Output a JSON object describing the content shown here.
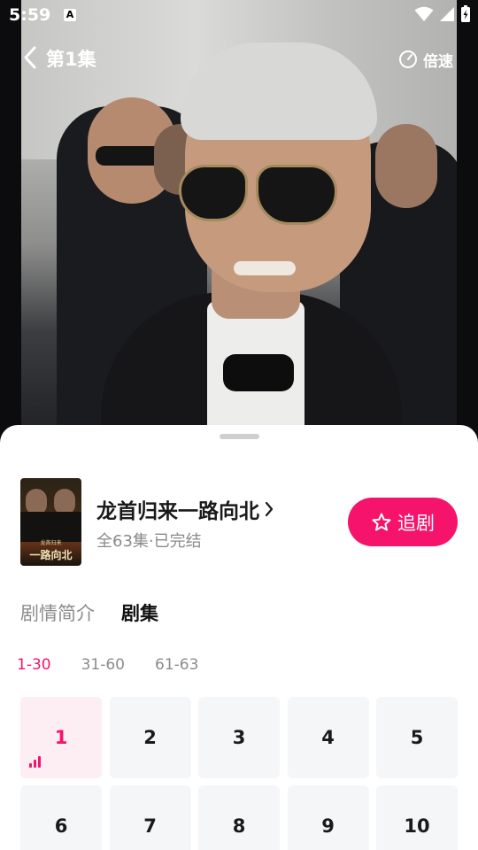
{
  "status_bar": {
    "time": "5:59",
    "notification_letter": "A"
  },
  "player": {
    "episode_title": "第1集",
    "speed_label": "倍速"
  },
  "drama": {
    "title": "龙首归来一路向北",
    "subtitle": "全63集·已完结",
    "poster_text": "一路向北",
    "poster_small_text": "龙首归来",
    "follow_label": "追剧"
  },
  "tabs": [
    {
      "label": "剧情简介",
      "active": false
    },
    {
      "label": "剧集",
      "active": true
    }
  ],
  "ranges": [
    {
      "label": "1-30",
      "active": true
    },
    {
      "label": "31-60",
      "active": false
    },
    {
      "label": "61-63",
      "active": false
    }
  ],
  "episodes": [
    "1",
    "2",
    "3",
    "4",
    "5",
    "6",
    "7",
    "8",
    "9",
    "10"
  ],
  "current_episode": "1",
  "colors": {
    "accent": "#f5136b",
    "cell_bg": "#f5f6f8",
    "active_cell_bg": "#fdeef3"
  }
}
